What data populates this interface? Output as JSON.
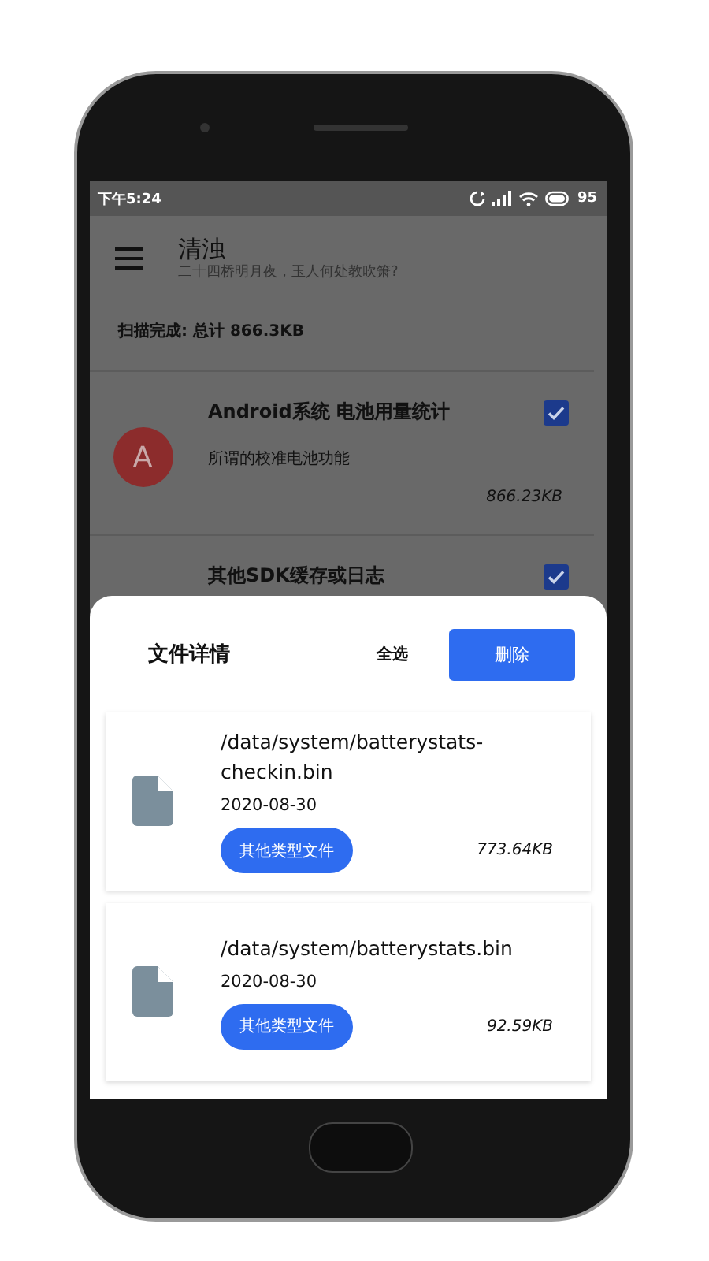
{
  "status_bar": {
    "time": "下午5:24",
    "battery": "95"
  },
  "app_bar": {
    "title": "清浊",
    "subtitle": "二十四桥明月夜，玉人何处教吹箫?"
  },
  "summary": "扫描完成: 总计 866.3KB",
  "items": [
    {
      "avatar": "A",
      "title": "Android系统 电池用量统计",
      "description": "所谓的校准电池功能",
      "size": "866.23KB",
      "checked": true
    },
    {
      "title": "其他SDK缓存或日志",
      "checked": true
    }
  ],
  "sheet": {
    "title": "文件详情",
    "select_all": "全选",
    "delete": "删除",
    "files": [
      {
        "path": "/data/system/batterystats-checkin.bin",
        "date": "2020-08-30",
        "type": "其他类型文件",
        "size": "773.64KB"
      },
      {
        "path": "/data/system/batterystats.bin",
        "date": "2020-08-30",
        "type": "其他类型文件",
        "size": "92.59KB"
      }
    ]
  }
}
